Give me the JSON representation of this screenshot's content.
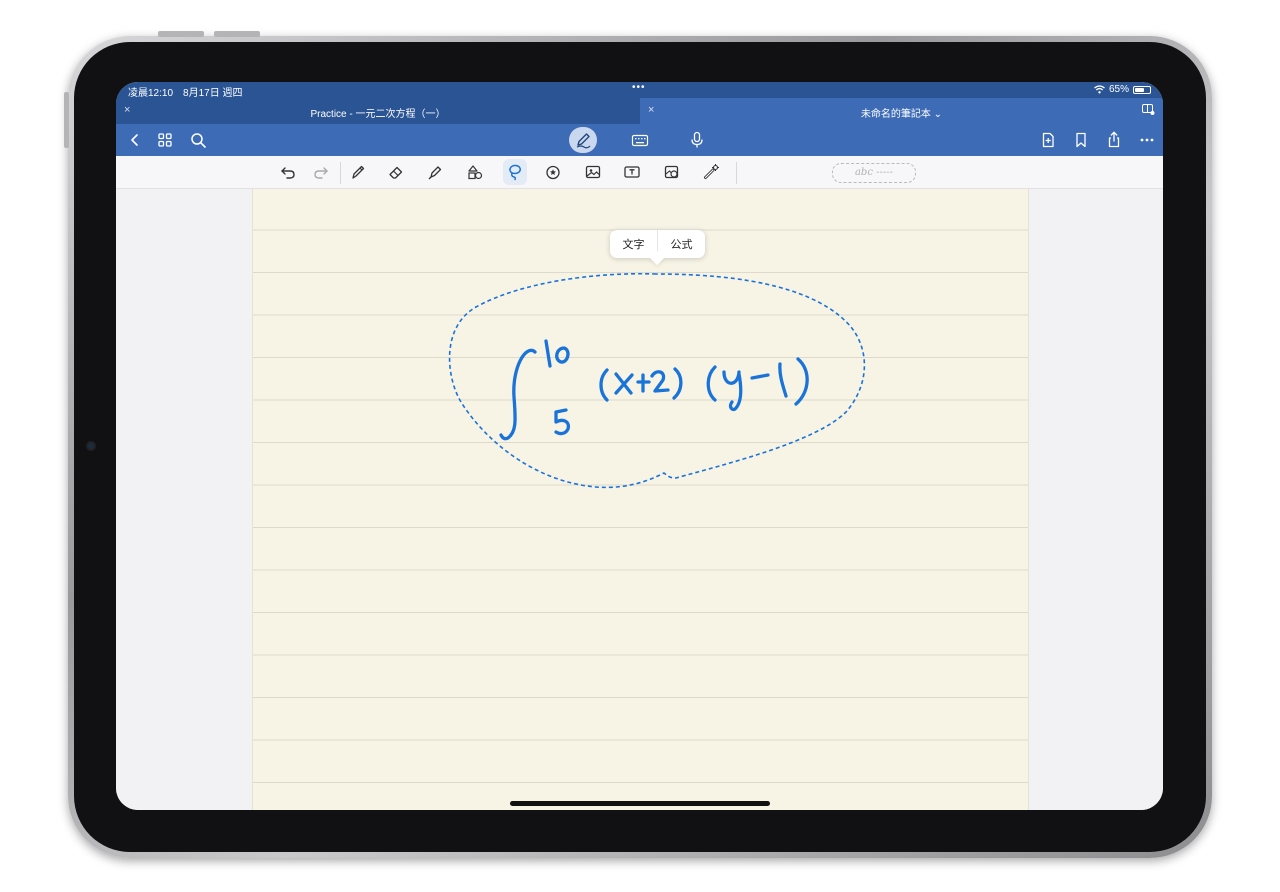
{
  "status": {
    "time": "凌晨12:10　8月17日 週四",
    "battery": "65%",
    "battery_level": 0.65
  },
  "tabs": [
    {
      "title": "Practice - 一元二次方程（一）"
    },
    {
      "title": "未命名的筆記本 ⌄"
    }
  ],
  "tab_close": "×",
  "handwriting_hint": "abc -----",
  "popup": {
    "text_option": "文字",
    "formula_option": "公式"
  },
  "ink": {
    "formula": "∫_5^10 (x+2)(y-1)",
    "color": "#1a73d9"
  },
  "colors": {
    "header": "#2a5494",
    "toolbar": "#3d6bb5",
    "paper": "#f7f4e6",
    "accent": "#1a73d9"
  },
  "icons": {
    "toolbar_left": [
      "chevron-left-icon",
      "grid-icon",
      "search-icon"
    ],
    "toolbar_center": [
      "pen-mode-icon",
      "keyboard-icon",
      "microphone-icon"
    ],
    "toolbar_right": [
      "add-page-icon",
      "bookmark-icon",
      "share-icon",
      "more-icon"
    ],
    "tools": [
      "undo-icon",
      "redo-icon",
      "pen-icon",
      "eraser-icon",
      "highlighter-icon",
      "shapes-icon",
      "lasso-icon",
      "sticker-icon",
      "image-icon",
      "textbox-icon",
      "camera-icon",
      "laser-pointer-icon"
    ]
  }
}
